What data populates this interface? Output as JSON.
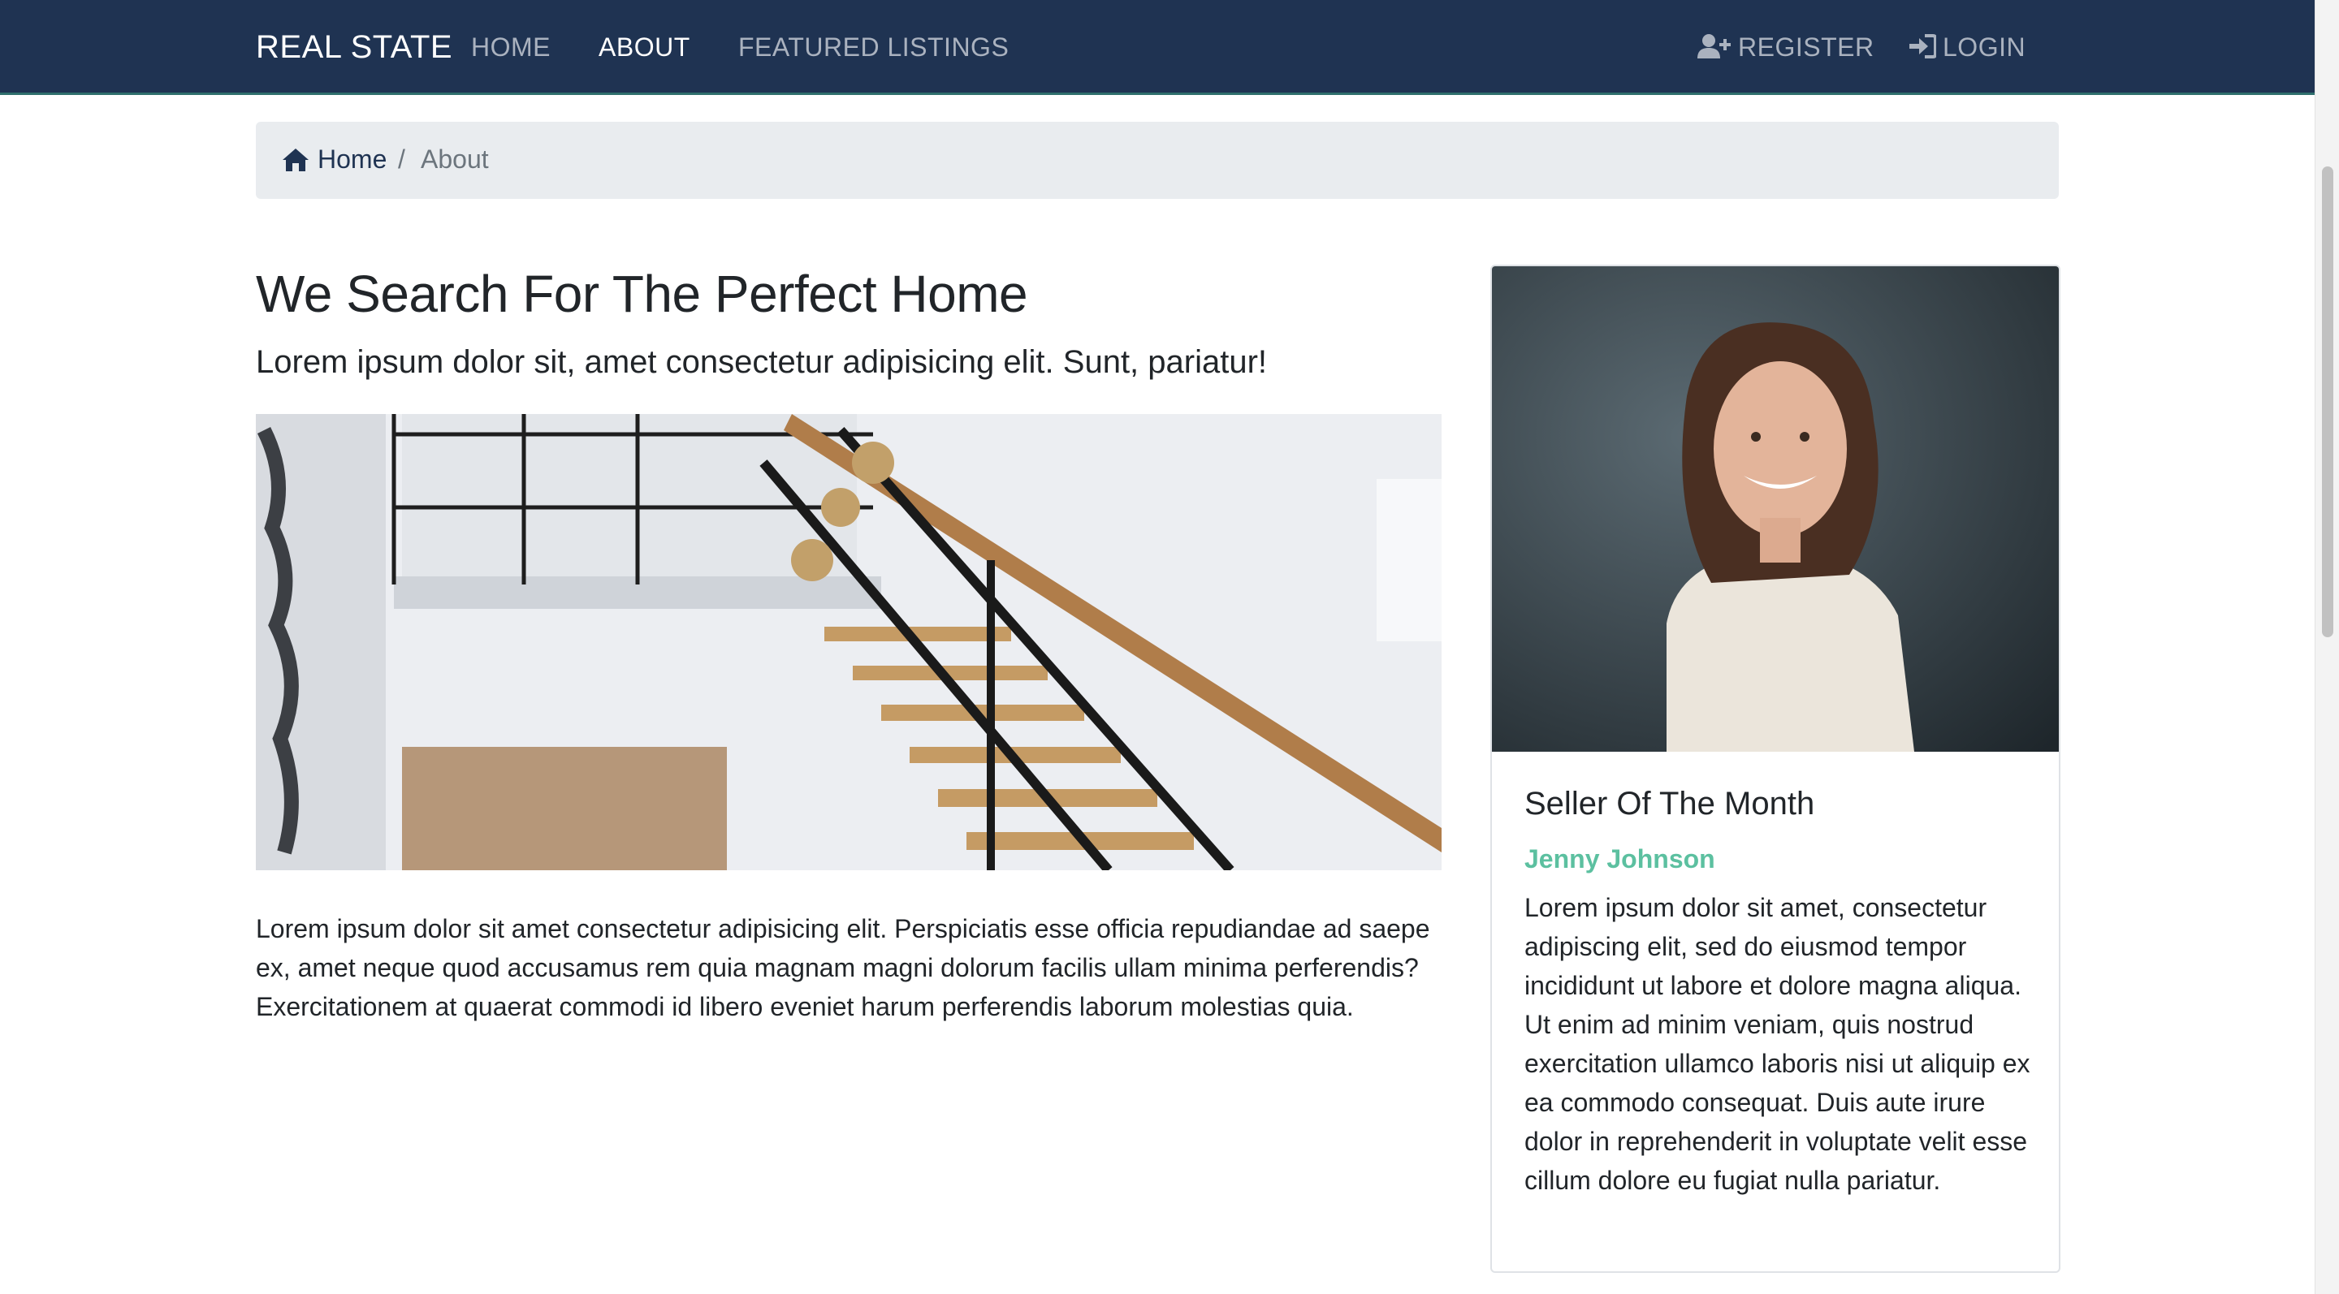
{
  "navbar": {
    "brand": "REAL STATE",
    "links": [
      {
        "label": "HOME"
      },
      {
        "label": "ABOUT"
      },
      {
        "label": "FEATURED LISTINGS"
      }
    ],
    "register_label": "REGISTER",
    "login_label": "LOGIN",
    "background_color": "#1f3352"
  },
  "breadcrumb": {
    "home_label": "Home",
    "separator": "/",
    "current": "About"
  },
  "main": {
    "heading": "We Search For The Perfect Home",
    "lead": "Lorem ipsum dolor sit, amet consectetur adipisicing elit. Sunt, pariatur!",
    "body": "Lorem ipsum dolor sit amet consectetur adipisicing elit. Perspiciatis esse officia repudiandae ad saepe ex, amet neque quod accusamus rem quia magnam magni dolorum facilis ullam minima perferendis? Exercitationem at quaerat commodi id libero eveniet harum perferendis laborum molestias quia."
  },
  "seller_card": {
    "title": "Seller Of The Month",
    "name": "Jenny Johnson",
    "text": "Lorem ipsum dolor sit amet, consectetur adipiscing elit, sed do eiusmod tempor incididunt ut labore et dolore magna aliqua. Ut enim ad minim veniam, quis nostrud exercitation ullamco laboris nisi ut aliquip ex ea commodo consequat. Duis aute irure dolor in reprehenderit in voluptate velit esse cillum dolore eu fugiat nulla pariatur.",
    "accent_color": "#5cc0a0"
  },
  "icons": {
    "register": "user-plus-icon",
    "login": "sign-in-icon",
    "home": "home-icon"
  }
}
